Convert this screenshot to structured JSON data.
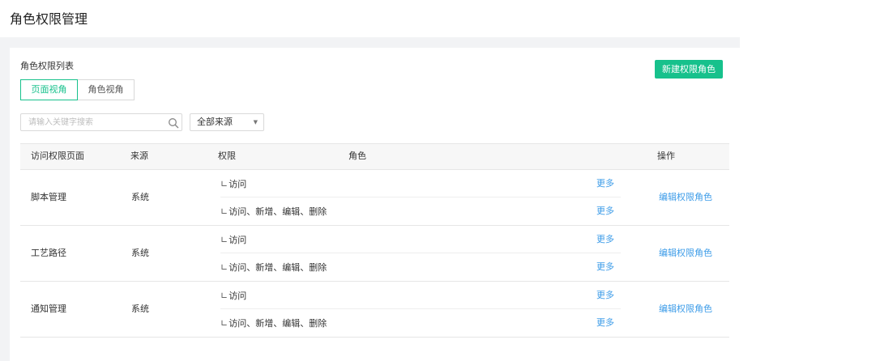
{
  "page_title": "角色权限管理",
  "card": {
    "title": "角色权限列表",
    "new_button": "新建权限角色"
  },
  "view_tabs": [
    {
      "label": "页面视角",
      "active": true
    },
    {
      "label": "角色视角",
      "active": false
    }
  ],
  "search": {
    "placeholder": "请输入关键字搜索",
    "value": ""
  },
  "source_filter": {
    "selected": "全部来源"
  },
  "table": {
    "columns": [
      "访问权限页面",
      "来源",
      "权限",
      "角色",
      "操作"
    ],
    "rows": [
      {
        "page": "脚本管理",
        "source": "系统",
        "permissions": [
          {
            "mark": "∟",
            "label": "访问",
            "more": "更多"
          },
          {
            "mark": "∟",
            "label": "访问、新增、编辑、删除",
            "more": "更多"
          }
        ],
        "action": "编辑权限角色"
      },
      {
        "page": "工艺路径",
        "source": "系统",
        "permissions": [
          {
            "mark": "∟",
            "label": "访问",
            "more": "更多"
          },
          {
            "mark": "∟",
            "label": "访问、新增、编辑、删除",
            "more": "更多"
          }
        ],
        "action": "编辑权限角色"
      },
      {
        "page": "通知管理",
        "source": "系统",
        "permissions": [
          {
            "mark": "∟",
            "label": "访问",
            "more": "更多"
          },
          {
            "mark": "∟",
            "label": "访问、新增、编辑、删除",
            "more": "更多"
          }
        ],
        "action": "编辑权限角色"
      }
    ]
  },
  "colors": {
    "primary": "#17c18c",
    "link": "#3d9ce8",
    "page_bg": "#f2f3f5"
  },
  "icons": {
    "search": "search-icon",
    "dropdown": "caret-down-icon"
  }
}
